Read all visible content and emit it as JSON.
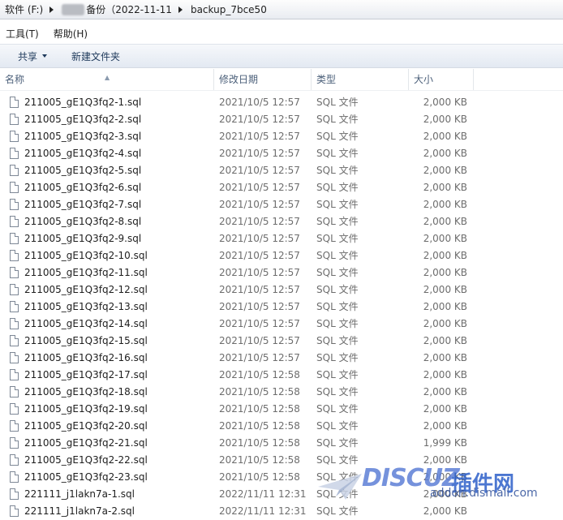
{
  "breadcrumb": {
    "drive": "软件 (F:)",
    "folder": "备份（2022-11-11",
    "subfolder": "backup_7bce50"
  },
  "menu": {
    "tools": "工具(T)",
    "help": "帮助(H)"
  },
  "toolbar": {
    "share": "共享",
    "new_folder": "新建文件夹"
  },
  "columns": {
    "name": "名称",
    "date": "修改日期",
    "type": "类型",
    "size": "大小"
  },
  "files": [
    {
      "name": "211005_gE1Q3fq2-1.sql",
      "date": "2021/10/5 12:57",
      "type": "SQL 文件",
      "size": "2,000 KB"
    },
    {
      "name": "211005_gE1Q3fq2-2.sql",
      "date": "2021/10/5 12:57",
      "type": "SQL 文件",
      "size": "2,000 KB"
    },
    {
      "name": "211005_gE1Q3fq2-3.sql",
      "date": "2021/10/5 12:57",
      "type": "SQL 文件",
      "size": "2,000 KB"
    },
    {
      "name": "211005_gE1Q3fq2-4.sql",
      "date": "2021/10/5 12:57",
      "type": "SQL 文件",
      "size": "2,000 KB"
    },
    {
      "name": "211005_gE1Q3fq2-5.sql",
      "date": "2021/10/5 12:57",
      "type": "SQL 文件",
      "size": "2,000 KB"
    },
    {
      "name": "211005_gE1Q3fq2-6.sql",
      "date": "2021/10/5 12:57",
      "type": "SQL 文件",
      "size": "2,000 KB"
    },
    {
      "name": "211005_gE1Q3fq2-7.sql",
      "date": "2021/10/5 12:57",
      "type": "SQL 文件",
      "size": "2,000 KB"
    },
    {
      "name": "211005_gE1Q3fq2-8.sql",
      "date": "2021/10/5 12:57",
      "type": "SQL 文件",
      "size": "2,000 KB"
    },
    {
      "name": "211005_gE1Q3fq2-9.sql",
      "date": "2021/10/5 12:57",
      "type": "SQL 文件",
      "size": "2,000 KB"
    },
    {
      "name": "211005_gE1Q3fq2-10.sql",
      "date": "2021/10/5 12:57",
      "type": "SQL 文件",
      "size": "2,000 KB"
    },
    {
      "name": "211005_gE1Q3fq2-11.sql",
      "date": "2021/10/5 12:57",
      "type": "SQL 文件",
      "size": "2,000 KB"
    },
    {
      "name": "211005_gE1Q3fq2-12.sql",
      "date": "2021/10/5 12:57",
      "type": "SQL 文件",
      "size": "2,000 KB"
    },
    {
      "name": "211005_gE1Q3fq2-13.sql",
      "date": "2021/10/5 12:57",
      "type": "SQL 文件",
      "size": "2,000 KB"
    },
    {
      "name": "211005_gE1Q3fq2-14.sql",
      "date": "2021/10/5 12:57",
      "type": "SQL 文件",
      "size": "2,000 KB"
    },
    {
      "name": "211005_gE1Q3fq2-15.sql",
      "date": "2021/10/5 12:57",
      "type": "SQL 文件",
      "size": "2,000 KB"
    },
    {
      "name": "211005_gE1Q3fq2-16.sql",
      "date": "2021/10/5 12:57",
      "type": "SQL 文件",
      "size": "2,000 KB"
    },
    {
      "name": "211005_gE1Q3fq2-17.sql",
      "date": "2021/10/5 12:58",
      "type": "SQL 文件",
      "size": "2,000 KB"
    },
    {
      "name": "211005_gE1Q3fq2-18.sql",
      "date": "2021/10/5 12:58",
      "type": "SQL 文件",
      "size": "2,000 KB"
    },
    {
      "name": "211005_gE1Q3fq2-19.sql",
      "date": "2021/10/5 12:58",
      "type": "SQL 文件",
      "size": "2,000 KB"
    },
    {
      "name": "211005_gE1Q3fq2-20.sql",
      "date": "2021/10/5 12:58",
      "type": "SQL 文件",
      "size": "2,000 KB"
    },
    {
      "name": "211005_gE1Q3fq2-21.sql",
      "date": "2021/10/5 12:58",
      "type": "SQL 文件",
      "size": "1,999 KB"
    },
    {
      "name": "211005_gE1Q3fq2-22.sql",
      "date": "2021/10/5 12:58",
      "type": "SQL 文件",
      "size": "2,000 KB"
    },
    {
      "name": "211005_gE1Q3fq2-23.sql",
      "date": "2021/10/5 12:58",
      "type": "SQL 文件",
      "size": "2,000 KB"
    },
    {
      "name": "221111_j1lakn7a-1.sql",
      "date": "2022/11/11 12:31",
      "type": "SQL 文件",
      "size": "2,000 KB"
    },
    {
      "name": "221111_j1lakn7a-2.sql",
      "date": "2022/11/11 12:31",
      "type": "SQL 文件",
      "size": "2,000 KB"
    }
  ],
  "watermark": {
    "brand": "DISCUZ",
    "brand_cn": "插件网",
    "url": "addon.dismall.com"
  }
}
